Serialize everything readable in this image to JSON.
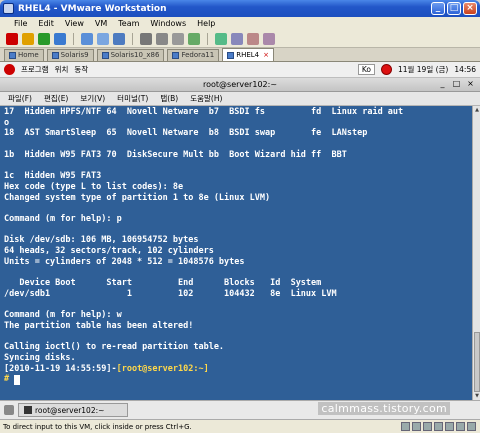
{
  "window": {
    "title": "RHEL4 - VMware Workstation"
  },
  "menubar": [
    "File",
    "Edit",
    "View",
    "VM",
    "Team",
    "Windows",
    "Help"
  ],
  "tabs": [
    {
      "label": "Home",
      "active": false
    },
    {
      "label": "Solaris9",
      "active": false
    },
    {
      "label": "Solaris10_x86",
      "active": false
    },
    {
      "label": "Fedora11",
      "active": false
    },
    {
      "label": "RHEL4",
      "active": true
    }
  ],
  "guest_panel": {
    "apps_menu": "프로그램",
    "places_menu": "위치",
    "actions_menu": "동작",
    "input_method": "Ko",
    "date": "11월 19일 (금)",
    "time": "14:56"
  },
  "terminal": {
    "title": "root@server102:~",
    "menu": [
      "파일(F)",
      "편집(E)",
      "보기(V)",
      "터미널(T)",
      "탭(B)",
      "도움말(H)"
    ],
    "lines": [
      "17  Hidden HPFS/NTF 64  Novell Netware  b7  BSDI fs         fd  Linux raid aut",
      "o",
      "18  AST SmartSleep  65  Novell Netware  b8  BSDI swap       fe  LANstep",
      "",
      "1b  Hidden W95 FAT3 70  DiskSecure Mult bb  Boot Wizard hid ff  BBT",
      "",
      "1c  Hidden W95 FAT3",
      "Hex code (type L to list codes): 8e",
      "Changed system type of partition 1 to 8e (Linux LVM)",
      "",
      "Command (m for help): p",
      "",
      "Disk /dev/sdb: 106 MB, 106954752 bytes",
      "64 heads, 32 sectors/track, 102 cylinders",
      "Units = cylinders of 2048 * 512 = 1048576 bytes",
      "",
      "   Device Boot      Start         End      Blocks   Id  System",
      "/dev/sdb1               1         102      104432   8e  Linux LVM",
      "",
      "Command (m for help): w",
      "The partition table has been altered!",
      "",
      "Calling ioctl() to re-read partition table.",
      "Syncing disks."
    ],
    "prompt_timestamp": "[2010-11-19 14:55:59]-",
    "prompt_user": "[root@server102:~]",
    "prompt_symbol": "#"
  },
  "taskbar": {
    "item": "root@server102:~"
  },
  "watermark": "calmmass.tistory.com",
  "statusbar": {
    "hint": "To direct input to this VM, click inside or press Ctrl+G."
  }
}
